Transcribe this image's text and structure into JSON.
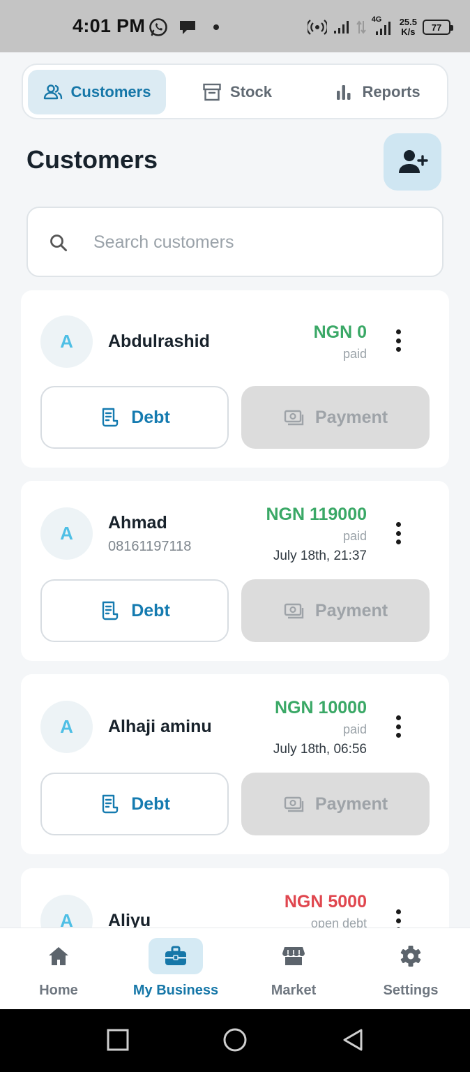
{
  "status_bar": {
    "time": "4:01 PM",
    "net_speed_value": "25.5",
    "net_speed_unit": "K/s",
    "network_type": "4G",
    "battery": "77"
  },
  "tabs": [
    {
      "label": "Customers",
      "icon": "users-icon",
      "active": true
    },
    {
      "label": "Stock",
      "icon": "archive-box-icon",
      "active": false
    },
    {
      "label": "Reports",
      "icon": "bar-chart-icon",
      "active": false
    }
  ],
  "page": {
    "title": "Customers",
    "add_customer_icon": "user-plus-icon"
  },
  "search": {
    "placeholder": "Search customers",
    "value": ""
  },
  "customers": [
    {
      "initial": "A",
      "name": "Abdulrashid",
      "phone": "",
      "amount": "NGN 0",
      "status": "paid",
      "date": "",
      "amount_color": "#3aa866"
    },
    {
      "initial": "A",
      "name": "Ahmad",
      "phone": "08161197118",
      "amount": "NGN 119000",
      "status": "paid",
      "date": "July 18th, 21:37",
      "amount_color": "#3aa866"
    },
    {
      "initial": "A",
      "name": "Alhaji aminu",
      "phone": "",
      "amount": "NGN 10000",
      "status": "paid",
      "date": "July 18th, 06:56",
      "amount_color": "#3aa866"
    },
    {
      "initial": "A",
      "name": "Aliyu",
      "phone": "",
      "amount": "NGN 5000",
      "status": "open debt",
      "date": "",
      "amount_color": "#e0474f"
    }
  ],
  "card_actions": {
    "debt_label": "Debt",
    "payment_label": "Payment"
  },
  "bottom_nav": [
    {
      "label": "Home",
      "icon": "home-icon",
      "active": false
    },
    {
      "label": "My Business",
      "icon": "briefcase-icon",
      "active": true
    },
    {
      "label": "Market",
      "icon": "store-icon",
      "active": false
    },
    {
      "label": "Settings",
      "icon": "gear-icon",
      "active": false
    }
  ],
  "colors": {
    "accent": "#1677a8",
    "paid": "#3aa866",
    "debt": "#e0474f",
    "active_tab_bg": "#dcebf3"
  }
}
